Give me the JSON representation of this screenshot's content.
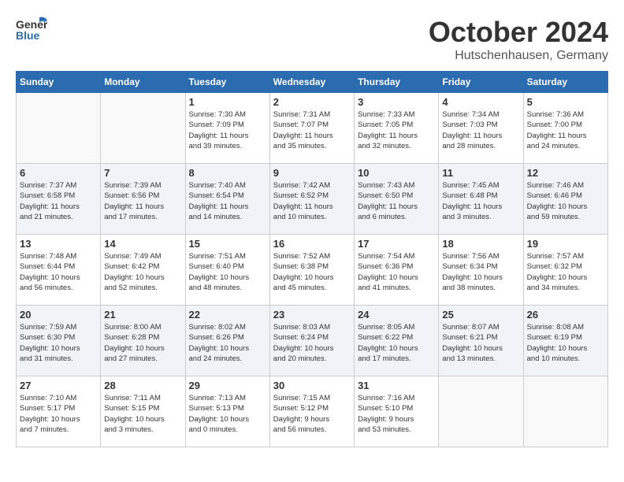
{
  "header": {
    "logo_general": "General",
    "logo_blue": "Blue",
    "month": "October 2024",
    "location": "Hutschenhausen, Germany"
  },
  "weekdays": [
    "Sunday",
    "Monday",
    "Tuesday",
    "Wednesday",
    "Thursday",
    "Friday",
    "Saturday"
  ],
  "weeks": [
    [
      {
        "day": "",
        "info": ""
      },
      {
        "day": "",
        "info": ""
      },
      {
        "day": "1",
        "info": "Sunrise: 7:30 AM\nSunset: 7:09 PM\nDaylight: 11 hours\nand 39 minutes."
      },
      {
        "day": "2",
        "info": "Sunrise: 7:31 AM\nSunset: 7:07 PM\nDaylight: 11 hours\nand 35 minutes."
      },
      {
        "day": "3",
        "info": "Sunrise: 7:33 AM\nSunset: 7:05 PM\nDaylight: 11 hours\nand 32 minutes."
      },
      {
        "day": "4",
        "info": "Sunrise: 7:34 AM\nSunset: 7:03 PM\nDaylight: 11 hours\nand 28 minutes."
      },
      {
        "day": "5",
        "info": "Sunrise: 7:36 AM\nSunset: 7:00 PM\nDaylight: 11 hours\nand 24 minutes."
      }
    ],
    [
      {
        "day": "6",
        "info": "Sunrise: 7:37 AM\nSunset: 6:58 PM\nDaylight: 11 hours\nand 21 minutes."
      },
      {
        "day": "7",
        "info": "Sunrise: 7:39 AM\nSunset: 6:56 PM\nDaylight: 11 hours\nand 17 minutes."
      },
      {
        "day": "8",
        "info": "Sunrise: 7:40 AM\nSunset: 6:54 PM\nDaylight: 11 hours\nand 14 minutes."
      },
      {
        "day": "9",
        "info": "Sunrise: 7:42 AM\nSunset: 6:52 PM\nDaylight: 11 hours\nand 10 minutes."
      },
      {
        "day": "10",
        "info": "Sunrise: 7:43 AM\nSunset: 6:50 PM\nDaylight: 11 hours\nand 6 minutes."
      },
      {
        "day": "11",
        "info": "Sunrise: 7:45 AM\nSunset: 6:48 PM\nDaylight: 11 hours\nand 3 minutes."
      },
      {
        "day": "12",
        "info": "Sunrise: 7:46 AM\nSunset: 6:46 PM\nDaylight: 10 hours\nand 59 minutes."
      }
    ],
    [
      {
        "day": "13",
        "info": "Sunrise: 7:48 AM\nSunset: 6:44 PM\nDaylight: 10 hours\nand 56 minutes."
      },
      {
        "day": "14",
        "info": "Sunrise: 7:49 AM\nSunset: 6:42 PM\nDaylight: 10 hours\nand 52 minutes."
      },
      {
        "day": "15",
        "info": "Sunrise: 7:51 AM\nSunset: 6:40 PM\nDaylight: 10 hours\nand 48 minutes."
      },
      {
        "day": "16",
        "info": "Sunrise: 7:52 AM\nSunset: 6:38 PM\nDaylight: 10 hours\nand 45 minutes."
      },
      {
        "day": "17",
        "info": "Sunrise: 7:54 AM\nSunset: 6:36 PM\nDaylight: 10 hours\nand 41 minutes."
      },
      {
        "day": "18",
        "info": "Sunrise: 7:56 AM\nSunset: 6:34 PM\nDaylight: 10 hours\nand 38 minutes."
      },
      {
        "day": "19",
        "info": "Sunrise: 7:57 AM\nSunset: 6:32 PM\nDaylight: 10 hours\nand 34 minutes."
      }
    ],
    [
      {
        "day": "20",
        "info": "Sunrise: 7:59 AM\nSunset: 6:30 PM\nDaylight: 10 hours\nand 31 minutes."
      },
      {
        "day": "21",
        "info": "Sunrise: 8:00 AM\nSunset: 6:28 PM\nDaylight: 10 hours\nand 27 minutes."
      },
      {
        "day": "22",
        "info": "Sunrise: 8:02 AM\nSunset: 6:26 PM\nDaylight: 10 hours\nand 24 minutes."
      },
      {
        "day": "23",
        "info": "Sunrise: 8:03 AM\nSunset: 6:24 PM\nDaylight: 10 hours\nand 20 minutes."
      },
      {
        "day": "24",
        "info": "Sunrise: 8:05 AM\nSunset: 6:22 PM\nDaylight: 10 hours\nand 17 minutes."
      },
      {
        "day": "25",
        "info": "Sunrise: 8:07 AM\nSunset: 6:21 PM\nDaylight: 10 hours\nand 13 minutes."
      },
      {
        "day": "26",
        "info": "Sunrise: 8:08 AM\nSunset: 6:19 PM\nDaylight: 10 hours\nand 10 minutes."
      }
    ],
    [
      {
        "day": "27",
        "info": "Sunrise: 7:10 AM\nSunset: 5:17 PM\nDaylight: 10 hours\nand 7 minutes."
      },
      {
        "day": "28",
        "info": "Sunrise: 7:11 AM\nSunset: 5:15 PM\nDaylight: 10 hours\nand 3 minutes."
      },
      {
        "day": "29",
        "info": "Sunrise: 7:13 AM\nSunset: 5:13 PM\nDaylight: 10 hours\nand 0 minutes."
      },
      {
        "day": "30",
        "info": "Sunrise: 7:15 AM\nSunset: 5:12 PM\nDaylight: 9 hours\nand 56 minutes."
      },
      {
        "day": "31",
        "info": "Sunrise: 7:16 AM\nSunset: 5:10 PM\nDaylight: 9 hours\nand 53 minutes."
      },
      {
        "day": "",
        "info": ""
      },
      {
        "day": "",
        "info": ""
      }
    ]
  ]
}
